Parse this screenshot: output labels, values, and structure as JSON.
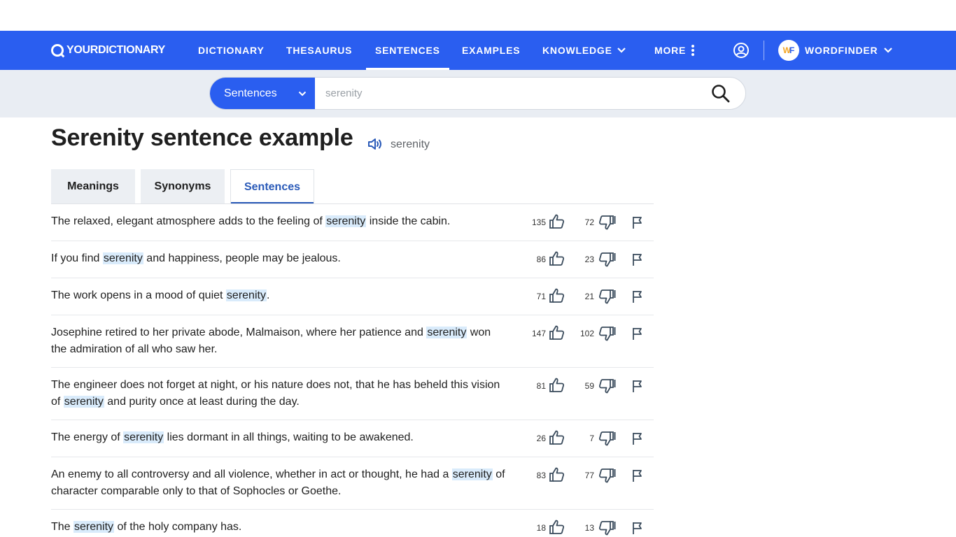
{
  "nav": {
    "logo": "YOURDICTIONARY",
    "items": [
      "DICTIONARY",
      "THESAURUS",
      "SENTENCES",
      "EXAMPLES",
      "KNOWLEDGE",
      "MORE"
    ],
    "active": "SENTENCES",
    "wordfinder": "WORDFINDER",
    "accent": "#2a5ef0"
  },
  "search": {
    "category": "Sentences",
    "value": "serenity"
  },
  "page": {
    "title": "Serenity sentence example",
    "pronunciation": "serenity"
  },
  "tabs": [
    "Meanings",
    "Synonyms",
    "Sentences"
  ],
  "sentences": [
    {
      "before": "The relaxed, elegant atmosphere adds to the feeling of ",
      "word": "serenity",
      "after": " inside the cabin.",
      "up": "135",
      "down": "72"
    },
    {
      "before": "If you find ",
      "word": "serenity",
      "after": " and happiness, people may be jealous.",
      "up": "86",
      "down": "23"
    },
    {
      "before": "The work opens in a mood of quiet ",
      "word": "serenity",
      "after": ".",
      "up": "71",
      "down": "21"
    },
    {
      "before": "Josephine retired to her private abode, Malmaison, where her patience and ",
      "word": "serenity",
      "after": " won the admiration of all who saw her.",
      "up": "147",
      "down": "102"
    },
    {
      "before": "The engineer does not forget at night, or his nature does not, that he has beheld this vision of ",
      "word": "serenity",
      "after": " and purity once at least during the day.",
      "up": "81",
      "down": "59"
    },
    {
      "before": "The energy of ",
      "word": "serenity",
      "after": " lies dormant in all things, waiting to be awakened.",
      "up": "26",
      "down": "7"
    },
    {
      "before": "An enemy to all controversy and all violence, whether in act or thought, he had a ",
      "word": "serenity",
      "after": " of character comparable only to that of Sophocles or Goethe.",
      "up": "83",
      "down": "77"
    },
    {
      "before": "The ",
      "word": "serenity",
      "after": " of the holy company has.",
      "up": "18",
      "down": "13"
    }
  ]
}
